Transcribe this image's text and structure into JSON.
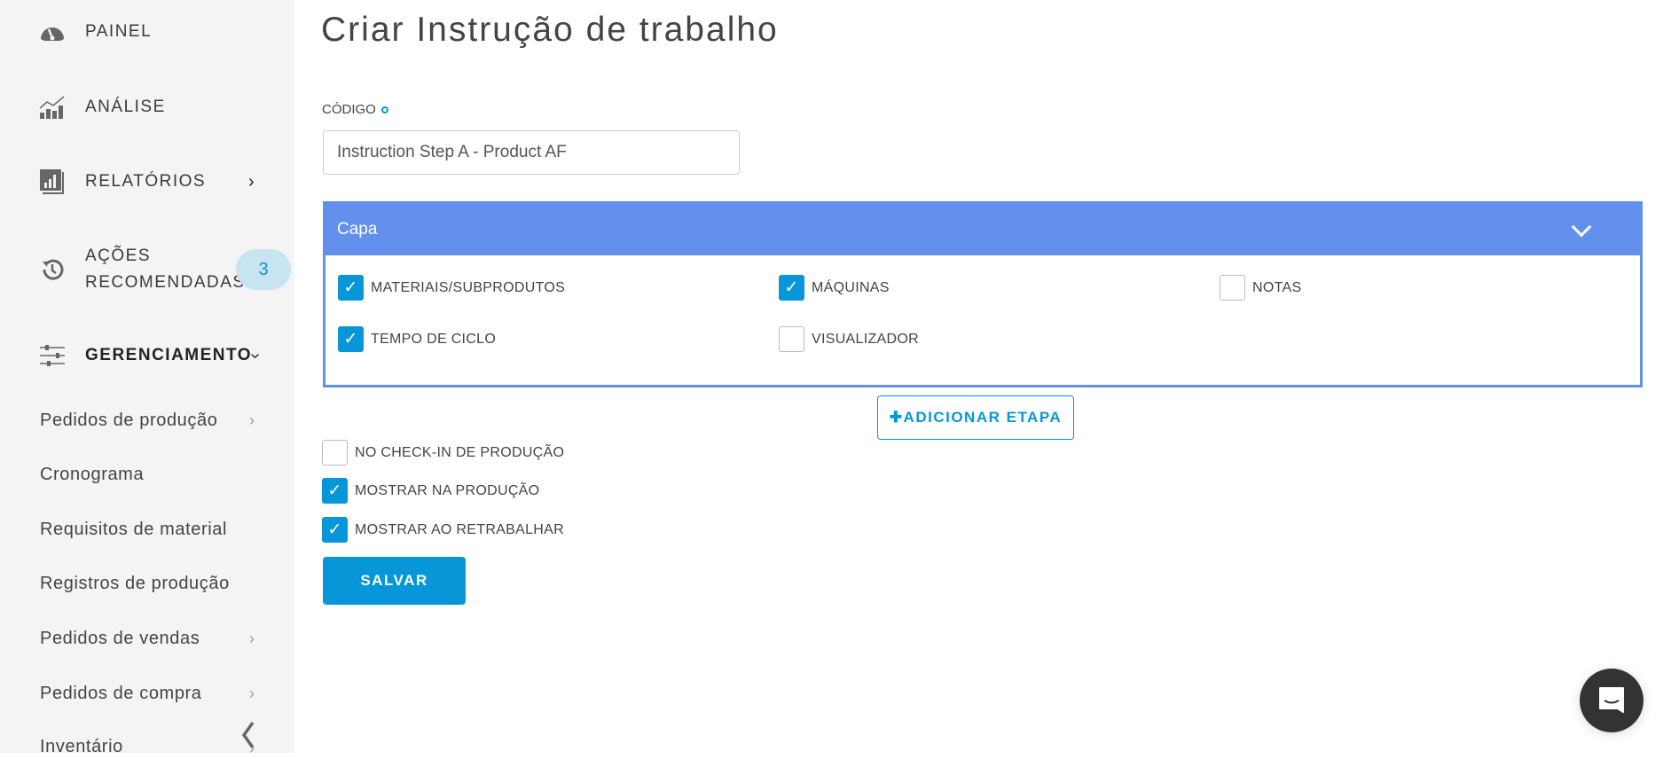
{
  "sidebar": {
    "items": [
      {
        "label": "PAINEL",
        "icon": "dashboard-gauge-icon"
      },
      {
        "label": "ANÁLISE",
        "icon": "analytics-chart-icon"
      },
      {
        "label": "RELATÓRIOS",
        "icon": "reports-icon"
      },
      {
        "label_line1": "AÇÕES",
        "label_line2": "RECOMENDADAS",
        "icon": "history-icon",
        "badge": "3"
      },
      {
        "label": "GERENCIAMENTO",
        "icon": "sliders-icon"
      }
    ],
    "sub_items": [
      {
        "label": "Pedidos de produção",
        "has_chevron": true
      },
      {
        "label": "Cronograma",
        "has_chevron": false
      },
      {
        "label": "Requisitos de material",
        "has_chevron": false
      },
      {
        "label": "Registros de produção",
        "has_chevron": false
      },
      {
        "label": "Pedidos de vendas",
        "has_chevron": true
      },
      {
        "label": "Pedidos de compra",
        "has_chevron": true
      },
      {
        "label": "Inventário",
        "has_chevron": true
      }
    ]
  },
  "page": {
    "title": "Criar Instrução de trabalho",
    "code_label": "CÓDIGO",
    "code_value": "Instruction Step A - Product AF",
    "panel": {
      "title": "Capa",
      "options": [
        {
          "label": "MATERIAIS/SUBPRODUTOS",
          "checked": true
        },
        {
          "label": "MÁQUINAS",
          "checked": true
        },
        {
          "label": "NOTAS",
          "checked": false
        },
        {
          "label": "TEMPO DE CICLO",
          "checked": true
        },
        {
          "label": "VISUALIZADOR",
          "checked": false
        }
      ]
    },
    "add_step_label": "ADICIONAR ETAPA",
    "options": [
      {
        "label": "NO CHECK-IN DE PRODUÇÃO",
        "checked": false
      },
      {
        "label": "MOSTRAR NA PRODUÇÃO",
        "checked": true
      },
      {
        "label": "MOSTRAR AO RETRABALHAR",
        "checked": true
      }
    ],
    "save_label": "SALVAR"
  },
  "colors": {
    "accent": "#0797d8",
    "panel": "#6490ed",
    "sidebar": "#f4f4f4"
  }
}
